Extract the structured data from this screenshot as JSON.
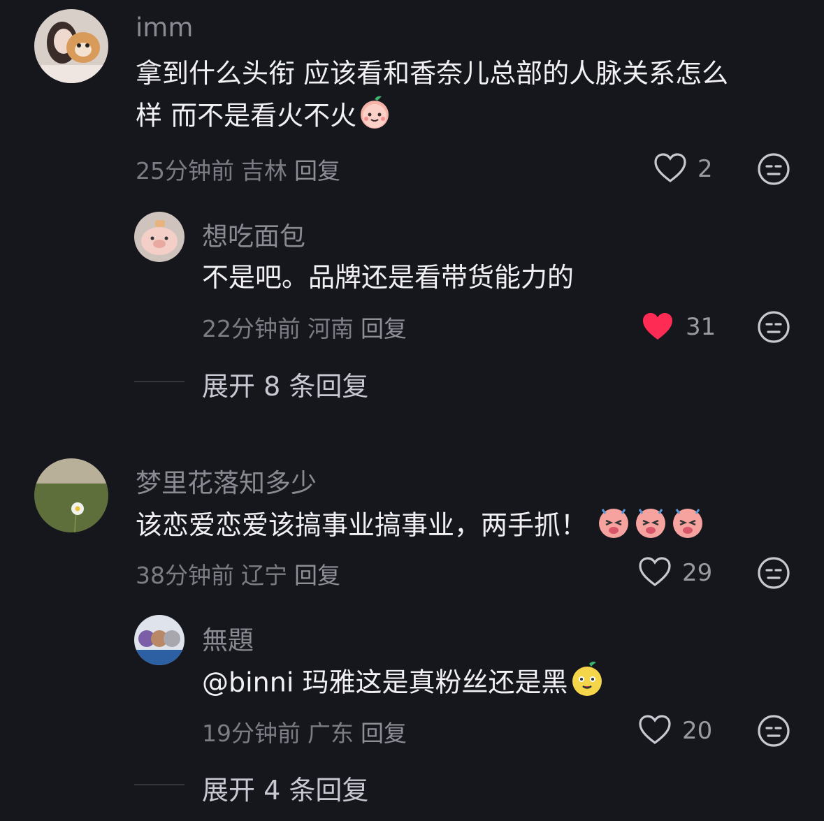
{
  "comments": [
    {
      "user": "imm",
      "text_line1": "拿到什么头衔 应该看和香奈儿总部的人脉关系怎么",
      "text_line2": "样 而不是看火不火",
      "emoji": "peach-smile-icon",
      "time": "25分钟前",
      "location": "吉林",
      "reply_label": "回复",
      "likes": "2",
      "liked": false
    },
    {
      "user": "想吃面包",
      "text": "不是吧。品牌还是看带货能力的",
      "time": "22分钟前",
      "location": "河南",
      "reply_label": "回复",
      "likes": "31",
      "liked": true
    },
    {
      "user": "梦里花落知多少",
      "text": "该恋爱恋爱该搞事业搞事业，两手抓！",
      "emoji": "laughing-pig-icon",
      "time": "38分钟前",
      "location": "辽宁",
      "reply_label": "回复",
      "likes": "29",
      "liked": false
    },
    {
      "user": "無題",
      "text": "@binni 玛雅这是真粉丝还是黑",
      "emoji": "yellow-face-icon",
      "time": "19分钟前",
      "location": "广东",
      "reply_label": "回复",
      "likes": "20",
      "liked": false
    }
  ],
  "expand_1": "展开 8 条回复",
  "expand_2": "展开 4 条回复",
  "colors": {
    "background": "#16161d",
    "heart_active": "#fe2c55"
  }
}
